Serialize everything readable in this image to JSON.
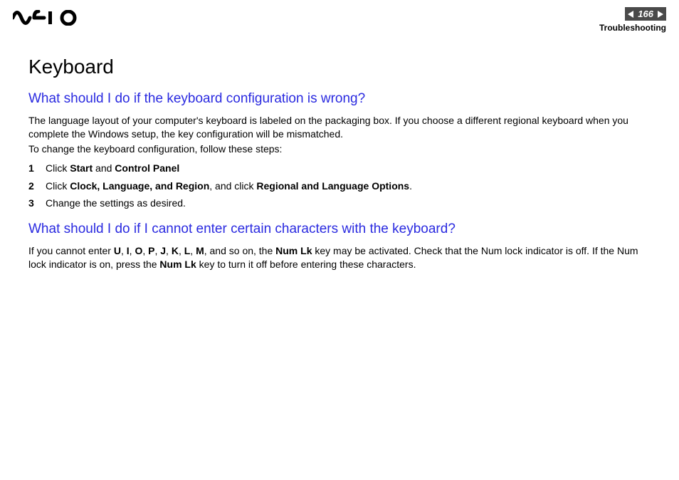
{
  "header": {
    "page_number": "166",
    "section": "Troubleshooting"
  },
  "title": "Keyboard",
  "q1": {
    "heading": "What should I do if the keyboard configuration is wrong?",
    "para1": "The language layout of your computer's keyboard is labeled on the packaging box. If you choose a different regional keyboard when you complete the Windows setup, the key configuration will be mismatched.",
    "para2": "To change the keyboard configuration, follow these steps:",
    "steps": [
      {
        "n": "1",
        "pre": "Click ",
        "b1": "Start",
        "mid": " and ",
        "b2": "Control Panel",
        "post": ""
      },
      {
        "n": "2",
        "pre": "Click ",
        "b1": "Clock, Language, and Region",
        "mid": ", and click ",
        "b2": "Regional and Language Options",
        "post": "."
      },
      {
        "n": "3",
        "pre": "Change the settings as desired.",
        "b1": "",
        "mid": "",
        "b2": "",
        "post": ""
      }
    ]
  },
  "q2": {
    "heading": "What should I do if I cannot enter certain characters with the keyboard?",
    "p_pre": "If you cannot enter ",
    "chars": [
      "U",
      "I",
      "O",
      "P",
      "J",
      "K",
      "L",
      "M"
    ],
    "p_mid1": ", and so on, the ",
    "numlk": "Num Lk",
    "p_mid2": " key may be activated. Check that the Num lock indicator is off. If the Num lock indicator is on, press the ",
    "p_post": " key to turn it off before entering these characters."
  }
}
